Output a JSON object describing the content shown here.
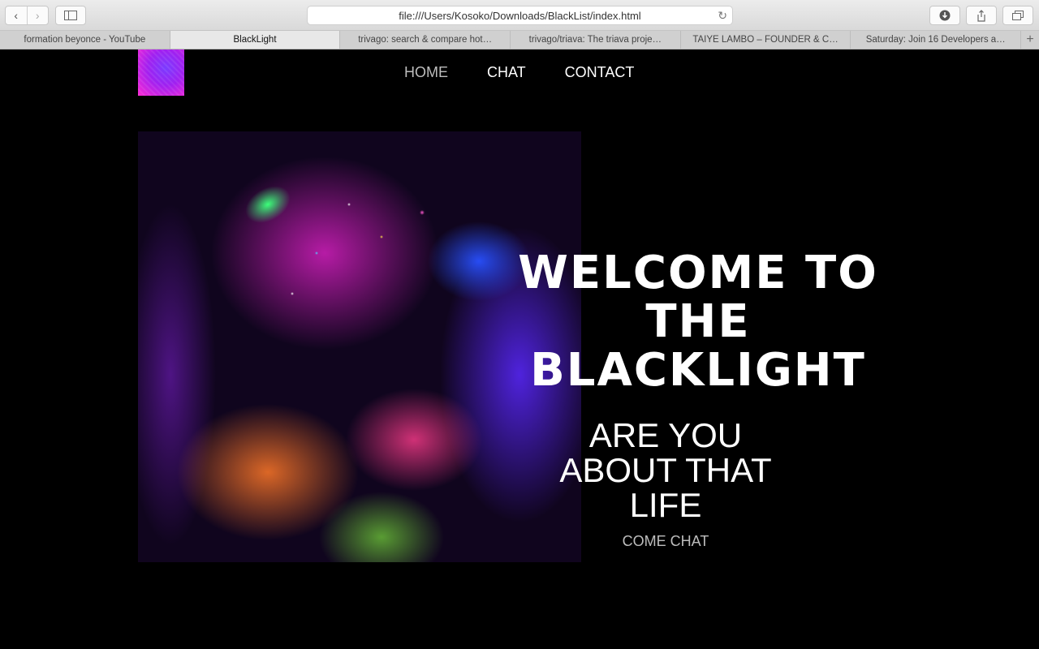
{
  "browser": {
    "address": "file:///Users/Kosoko/Downloads/BlackList/index.html",
    "tabs": [
      {
        "label": "formation beyonce - YouTube",
        "active": false
      },
      {
        "label": "BlackLight",
        "active": true
      },
      {
        "label": "trivago: search & compare hot…",
        "active": false
      },
      {
        "label": "trivago/triava: The triava proje…",
        "active": false
      },
      {
        "label": "TAIYE LAMBO – FOUNDER & C…",
        "active": false
      },
      {
        "label": "Saturday: Join 16 Developers a…",
        "active": false
      }
    ]
  },
  "nav": {
    "home": "HOME",
    "chat": "CHAT",
    "contact": "CONTACT"
  },
  "hero": {
    "welcome_line1": "WELCOME TO",
    "welcome_line2": "THE",
    "welcome_line3": "BLACKLIGHT",
    "tagline_line1": "ARE YOU",
    "tagline_line2": "ABOUT THAT",
    "tagline_line3": "LIFE",
    "cta": "COME CHAT"
  },
  "colors": {
    "background": "#000000",
    "text": "#ffffff",
    "muted": "#bdbdbd",
    "accent": "#a020f0"
  }
}
